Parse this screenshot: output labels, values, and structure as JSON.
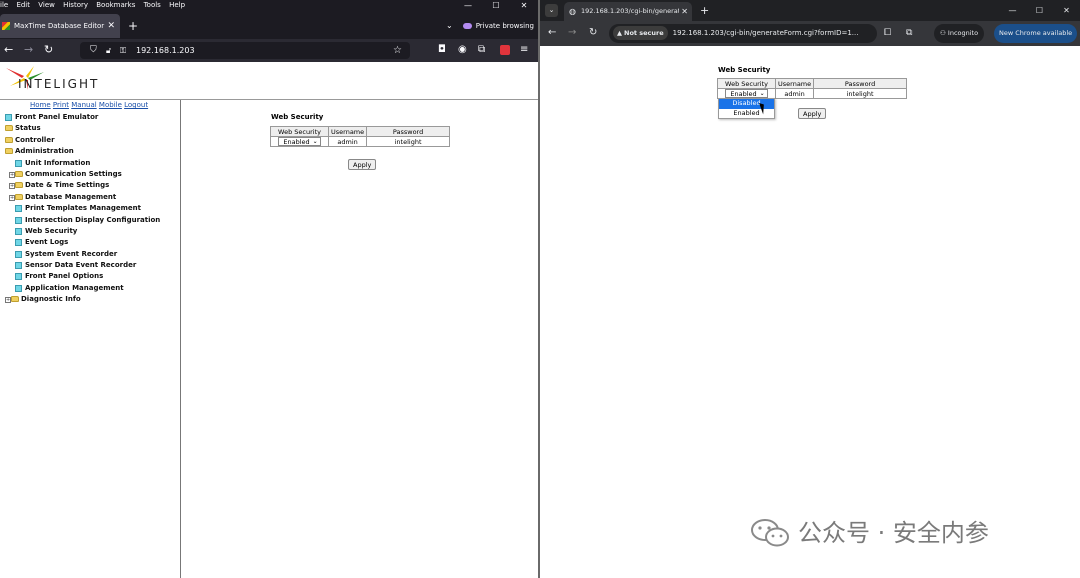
{
  "firefox": {
    "menubar": [
      "ile",
      "Edit",
      "View",
      "History",
      "Bookmarks",
      "Tools",
      "Help"
    ],
    "tab_title": "MaxTime Database Editor",
    "private_label": "Private browsing",
    "url": "192.168.1.203"
  },
  "page": {
    "logo_text": "INTELIGHT",
    "top_links": [
      "Home",
      "Print",
      "Manual",
      "Mobile",
      "Logout"
    ],
    "tree": [
      {
        "label": "Front Panel Emulator",
        "level": 0,
        "kind": "page",
        "expander": false
      },
      {
        "label": "Status",
        "level": 0,
        "kind": "folder",
        "expander": false
      },
      {
        "label": "Controller",
        "level": 0,
        "kind": "folder",
        "expander": false
      },
      {
        "label": "Administration",
        "level": 0,
        "kind": "folder-open",
        "expander": false
      },
      {
        "label": "Unit Information",
        "level": 1,
        "kind": "page",
        "expander": false
      },
      {
        "label": "Communication Settings",
        "level": 1,
        "kind": "folder",
        "expander": true
      },
      {
        "label": "Date & Time Settings",
        "level": 1,
        "kind": "folder",
        "expander": true
      },
      {
        "label": "Database Management",
        "level": 1,
        "kind": "folder",
        "expander": true
      },
      {
        "label": "Print Templates Management",
        "level": 1,
        "kind": "page",
        "expander": false
      },
      {
        "label": "Intersection Display Configuration",
        "level": 1,
        "kind": "page",
        "expander": false
      },
      {
        "label": "Web Security",
        "level": 1,
        "kind": "page",
        "expander": false
      },
      {
        "label": "Event Logs",
        "level": 1,
        "kind": "page",
        "expander": false
      },
      {
        "label": "System Event Recorder",
        "level": 1,
        "kind": "page",
        "expander": false
      },
      {
        "label": "Sensor Data Event Recorder",
        "level": 1,
        "kind": "page",
        "expander": false
      },
      {
        "label": "Front Panel Options",
        "level": 1,
        "kind": "page",
        "expander": false
      },
      {
        "label": "Application Management",
        "level": 1,
        "kind": "page",
        "expander": false
      },
      {
        "label": "Diagnostic Info",
        "level": 0,
        "kind": "folder",
        "expander": true
      }
    ],
    "web_security": {
      "title": "Web Security",
      "headers": [
        "Web Security",
        "Username",
        "Password"
      ],
      "selected": "Enabled",
      "username": "admin",
      "password": "intelight",
      "apply_label": "Apply"
    }
  },
  "chrome": {
    "tab_title": "192.168.1.203/cgi-bin/generate",
    "not_secure": "Not secure",
    "url": "192.168.1.203/cgi-bin/generateForm.cgi?formID=1...",
    "incognito": "Incognito",
    "new_chrome": "New Chrome available",
    "web_security": {
      "title": "Web Security",
      "headers": [
        "Web Security",
        "Username",
        "Password"
      ],
      "selected": "Enabled",
      "username": "admin",
      "password": "intelight",
      "apply_label": "Apply",
      "options": [
        "Disabled",
        "Enabled"
      ],
      "highlighted": "Disabled"
    }
  },
  "watermark": {
    "text": "公众号 · 安全内参"
  },
  "colors": {
    "firefox_dark": "#1c1b22",
    "chrome_dark": "#202124",
    "link_blue": "#1a4fa8",
    "dropdown_highlight": "#1a73e8"
  }
}
